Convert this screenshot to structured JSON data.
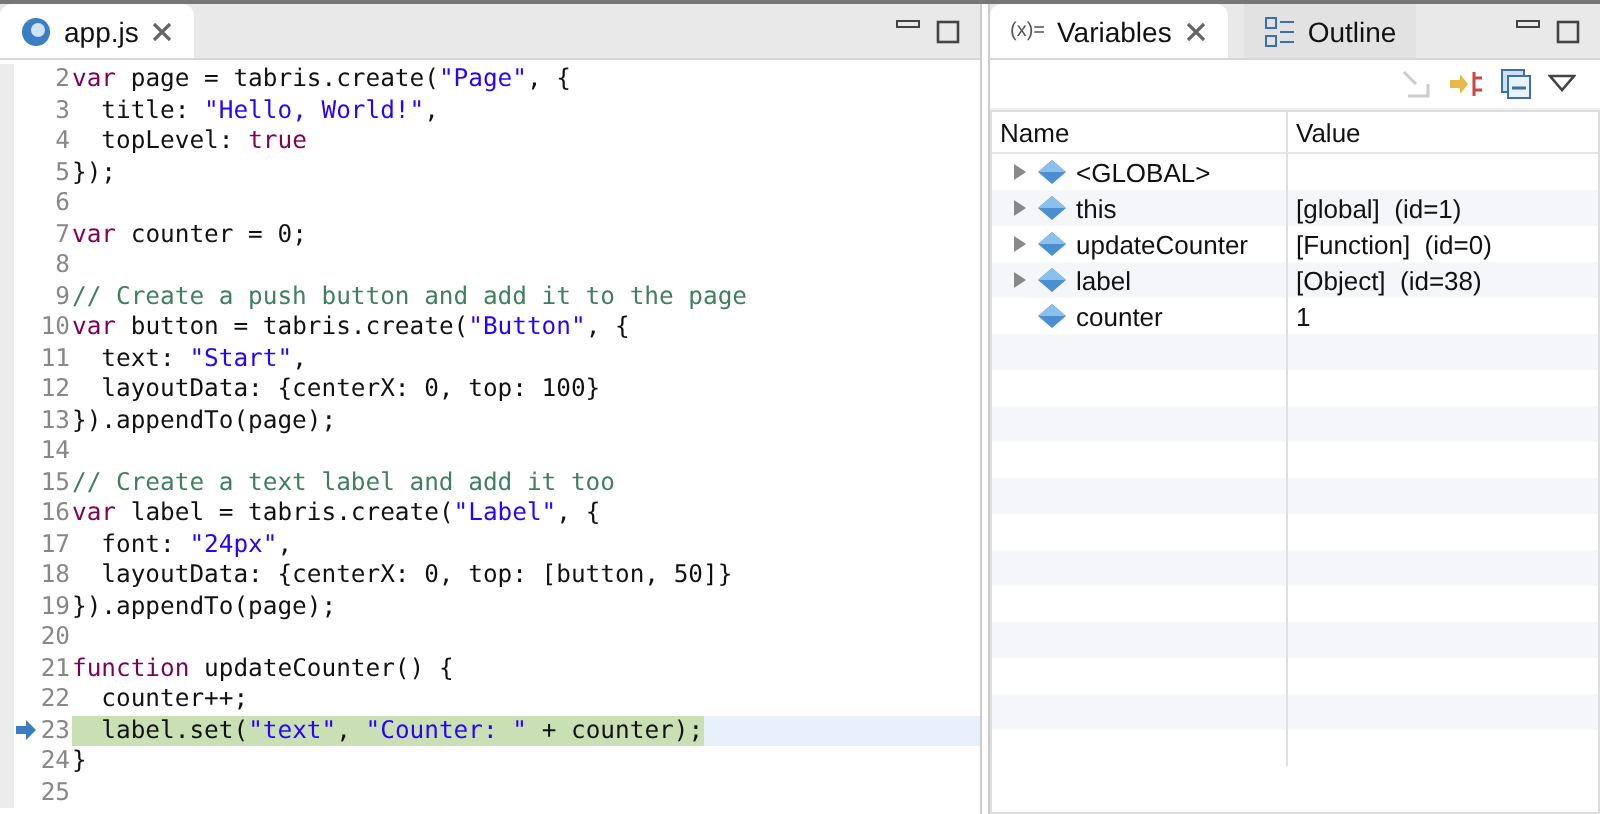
{
  "editor": {
    "tab": {
      "title": "app.js",
      "selected": true
    },
    "lines": [
      {
        "number": "2",
        "tokens": [
          {
            "kind": "keyword",
            "text": "var"
          },
          {
            "kind": "plain",
            "text": " page = tabris.create("
          },
          {
            "kind": "string",
            "text": "\"Page\""
          },
          {
            "kind": "plain",
            "text": ", {"
          }
        ]
      },
      {
        "number": "3",
        "tokens": [
          {
            "kind": "plain",
            "text": "  title: "
          },
          {
            "kind": "string",
            "text": "\"Hello, World!\""
          },
          {
            "kind": "plain",
            "text": ","
          }
        ]
      },
      {
        "number": "4",
        "tokens": [
          {
            "kind": "plain",
            "text": "  topLevel: "
          },
          {
            "kind": "keyword",
            "text": "true"
          }
        ]
      },
      {
        "number": "5",
        "tokens": [
          {
            "kind": "plain",
            "text": "});"
          }
        ]
      },
      {
        "number": "6"
      },
      {
        "number": "7",
        "tokens": [
          {
            "kind": "keyword",
            "text": "var"
          },
          {
            "kind": "plain",
            "text": " counter = 0;"
          }
        ]
      },
      {
        "number": "8"
      },
      {
        "number": "9",
        "tokens": [
          {
            "kind": "comment",
            "text": "// Create a push button and add it to the page"
          }
        ]
      },
      {
        "number": "10",
        "tokens": [
          {
            "kind": "keyword",
            "text": "var"
          },
          {
            "kind": "plain",
            "text": " button = tabris.create("
          },
          {
            "kind": "string",
            "text": "\"Button\""
          },
          {
            "kind": "plain",
            "text": ", {"
          }
        ]
      },
      {
        "number": "11",
        "tokens": [
          {
            "kind": "plain",
            "text": "  text: "
          },
          {
            "kind": "string",
            "text": "\"Start\""
          },
          {
            "kind": "plain",
            "text": ","
          }
        ]
      },
      {
        "number": "12",
        "tokens": [
          {
            "kind": "plain",
            "text": "  layoutData: {centerX: 0, top: 100}"
          }
        ]
      },
      {
        "number": "13",
        "tokens": [
          {
            "kind": "plain",
            "text": "}).appendTo(page);"
          }
        ]
      },
      {
        "number": "14"
      },
      {
        "number": "15",
        "tokens": [
          {
            "kind": "comment",
            "text": "// Create a text label and add it too"
          }
        ]
      },
      {
        "number": "16",
        "tokens": [
          {
            "kind": "keyword",
            "text": "var"
          },
          {
            "kind": "plain",
            "text": " label = tabris.create("
          },
          {
            "kind": "string",
            "text": "\"Label\""
          },
          {
            "kind": "plain",
            "text": ", {"
          }
        ]
      },
      {
        "number": "17",
        "tokens": [
          {
            "kind": "plain",
            "text": "  font: "
          },
          {
            "kind": "string",
            "text": "\"24px\""
          },
          {
            "kind": "plain",
            "text": ","
          }
        ]
      },
      {
        "number": "18",
        "tokens": [
          {
            "kind": "plain",
            "text": "  layoutData: {centerX: 0, top: [button, 50]}"
          }
        ]
      },
      {
        "number": "19",
        "tokens": [
          {
            "kind": "plain",
            "text": "}).appendTo(page);"
          }
        ]
      },
      {
        "number": "20"
      },
      {
        "number": "21",
        "tokens": [
          {
            "kind": "keyword",
            "text": "function"
          },
          {
            "kind": "plain",
            "text": " updateCounter() {"
          }
        ]
      },
      {
        "number": "22",
        "tokens": [
          {
            "kind": "plain",
            "text": "  counter++;"
          }
        ]
      },
      {
        "number": "23",
        "current": true,
        "tokens": [
          {
            "kind": "plain",
            "text": "  label.set("
          },
          {
            "kind": "string",
            "text": "\"text\""
          },
          {
            "kind": "plain",
            "text": ", "
          },
          {
            "kind": "string",
            "text": "\"Counter: \""
          },
          {
            "kind": "plain",
            "text": " + counter);"
          }
        ]
      },
      {
        "number": "24",
        "tokens": [
          {
            "kind": "plain",
            "text": "}"
          }
        ]
      },
      {
        "number": "25"
      }
    ]
  },
  "variables_view": {
    "tabs": [
      {
        "label": "Variables",
        "prefix": "(x)=",
        "kind": "variables",
        "selected": true
      },
      {
        "label": "Outline",
        "kind": "outline",
        "selected": false
      }
    ],
    "columns": [
      "Name",
      "Value"
    ],
    "rows": [
      {
        "name": "<GLOBAL>",
        "expandable": true
      },
      {
        "name": "this",
        "value": "[global]  (id=1)",
        "expandable": true
      },
      {
        "name": "updateCounter",
        "value": "[Function]  (id=0)",
        "expandable": true
      },
      {
        "name": "label",
        "value": "[Object]  (id=38)",
        "expandable": true
      },
      {
        "name": "counter",
        "value": "1",
        "expandable": false
      }
    ]
  }
}
